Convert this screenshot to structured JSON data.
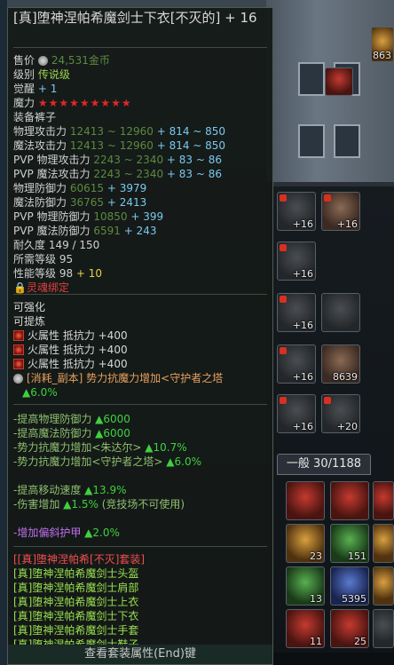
{
  "item": {
    "title": "[真]堕神涅帕希魔剑士下衣[不灭的] + 16",
    "price_label": "售价",
    "price_value": "24,531金币",
    "rank_label": "级别",
    "rank_value": "传说级",
    "awaken_label": "觉醒",
    "awaken_value": "+ 1",
    "magic_label": "魔力",
    "magic_stars": "★★★★★★★★★",
    "equip_label": "装备",
    "equip_value": "裤子",
    "stats": [
      {
        "label": "物理攻击力",
        "base": "12413 ~ 12960",
        "bonus": "+ 814 ~ 850"
      },
      {
        "label": "魔法攻击力",
        "base": "12413 ~ 12960",
        "bonus": "+ 814 ~ 850"
      },
      {
        "label": "PVP 物理攻击力",
        "base": "2243 ~ 2340",
        "bonus": "+ 83 ~ 86"
      },
      {
        "label": "PVP 魔法攻击力",
        "base": "2243 ~ 2340",
        "bonus": "+ 83 ~ 86"
      },
      {
        "label": "物理防御力",
        "base": "60615",
        "bonus": "+ 3979"
      },
      {
        "label": "魔法防御力",
        "base": "36765",
        "bonus": "+ 2413"
      },
      {
        "label": "PVP 物理防御力",
        "base": "10850",
        "bonus": "+ 399"
      },
      {
        "label": "PVP 魔法防御力",
        "base": "6591",
        "bonus": "+ 243"
      }
    ],
    "durability": "耐久度 149 / 150",
    "req_level": "所需等级 95",
    "perf_level_label": "性能等级 98",
    "perf_level_bonus": "+ 10",
    "soulbound": "灵魂绑定",
    "can_enhance": "可强化",
    "can_refine": "可提炼",
    "fire_res": [
      "火属性 抵抗力 +400",
      "火属性 抵抗力 +400",
      "火属性 抵抗力 +400"
    ],
    "consumable_line": "[消耗_副本] 势力抗魔力增加<守护者之塔",
    "consumable_val": "▲6.0%",
    "bonuses": [
      {
        "label": "-提高物理防御力",
        "val": "▲6000"
      },
      {
        "label": "-提高魔法防御力",
        "val": "▲6000"
      },
      {
        "label": "-势力抗魔力增加<朱达尔>",
        "val": "▲10.7%"
      },
      {
        "label": "-势力抗魔力增加<守护者之塔>",
        "val": "▲6.0%"
      }
    ],
    "move_speed_label": "-提高移动速度",
    "move_speed_val": "▲13.9%",
    "damage_label": "-伤害增加",
    "damage_val": "▲1.5%",
    "damage_note": "(竞技场不可使用)",
    "armor_label": "-增加偏斜护甲",
    "armor_val": "▲2.0%",
    "set_title": "[[真]堕神涅帕希[不灭]套装]",
    "set_items": [
      "[真]堕神涅帕希魔剑士头盔",
      "[真]堕神涅帕希魔剑士肩部",
      "[真]堕神涅帕希魔剑士上衣",
      "[真]堕神涅帕希魔剑士下衣",
      "[真]堕神涅帕希魔剑士手套",
      "[真]堕神涅帕希魔剑士鞋子"
    ],
    "footer": "查看套装属性(End)键"
  },
  "inventory": {
    "tab_label": "一般 30/1188",
    "equip_slots": [
      {
        "count": "+16"
      },
      {
        "count": "+16"
      },
      {
        "count": "+16"
      },
      {
        "count": "+16"
      },
      {
        "count": "+16"
      },
      {
        "count": "8639"
      },
      {
        "count": "+16"
      },
      {
        "count": "+20"
      }
    ],
    "bag_slots": [
      {
        "count": ""
      },
      {
        "count": ""
      },
      {
        "count": "23"
      },
      {
        "count": "151"
      },
      {
        "count": "13"
      },
      {
        "count": "5395"
      },
      {
        "count": "11"
      },
      {
        "count": "25"
      }
    ],
    "top_counter": "863"
  },
  "colors": {
    "tooltip_bg": "#141a16",
    "legend_green": "#9ad050",
    "bonus_blue": "#7ac8f0",
    "stat_green": "#5c8a40",
    "star_red": "#e02828",
    "set_green": "#9ae050"
  }
}
